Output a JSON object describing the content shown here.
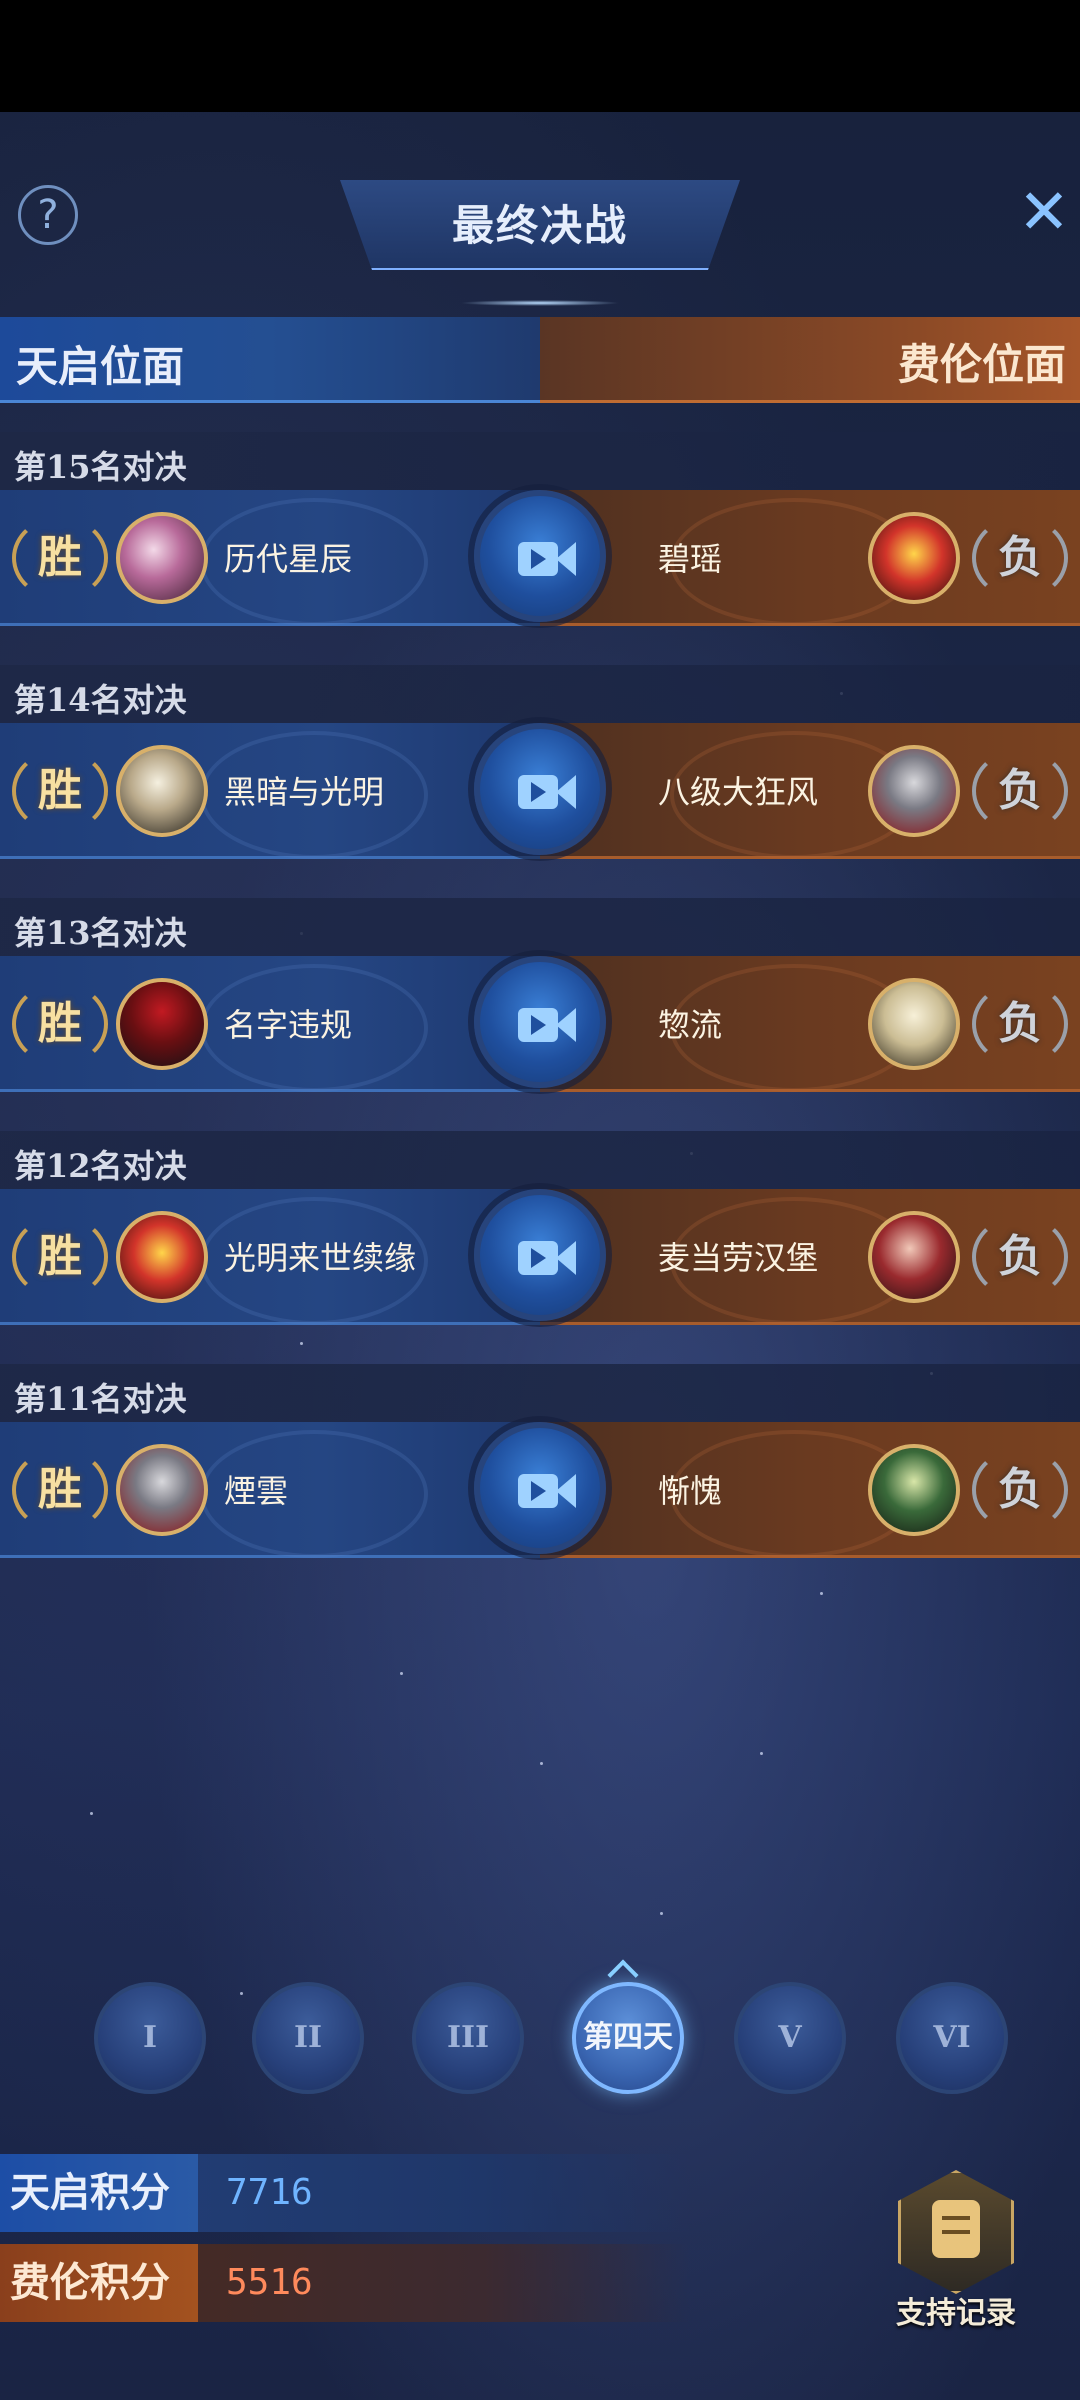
{
  "title": "最终决战",
  "factions": {
    "left": "天启位面",
    "right": "费伦位面"
  },
  "matches": [
    {
      "label": "第15名对决",
      "result_left": "胜",
      "player_left": "历代星辰",
      "player_right": "碧瑶",
      "result_right": "负"
    },
    {
      "label": "第14名对决",
      "result_left": "胜",
      "player_left": "黑暗与光明",
      "player_right": "八级大狂风",
      "result_right": "负"
    },
    {
      "label": "第13名对决",
      "result_left": "胜",
      "player_left": "名字违规",
      "player_right": "惣流",
      "result_right": "负"
    },
    {
      "label": "第12名对决",
      "result_left": "胜",
      "player_left": "光明来世续缘",
      "player_right": "麦当劳汉堡",
      "result_right": "负"
    },
    {
      "label": "第11名对决",
      "result_left": "胜",
      "player_left": "煙雲",
      "player_right": "惭愧",
      "result_right": "负"
    }
  ],
  "days": [
    "I",
    "II",
    "III",
    "第四天",
    "V",
    "VI"
  ],
  "active_day": "第四天",
  "scores": {
    "sky_label": "天启积分",
    "sky_value": "7716",
    "fei_label": "费伦积分",
    "fei_value": "5516"
  },
  "support_label": "支持记录",
  "icons": {
    "help": "question-icon",
    "close": "close-icon",
    "replay": "video-camera-icon",
    "support": "document-icon"
  },
  "colors": {
    "sky_accent": "#2a5aa6",
    "fei_accent": "#a3521f",
    "sky_score": "#6fb4ff",
    "fei_score": "#ff8a5c"
  }
}
